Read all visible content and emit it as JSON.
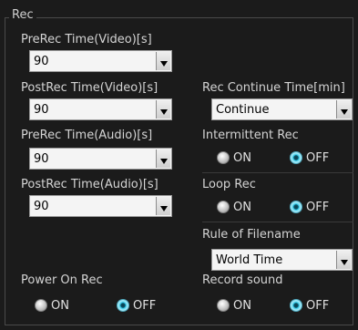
{
  "section_title": "Rec",
  "prerec_video": {
    "label": "PreRec Time(Video)[s]",
    "value": "90"
  },
  "postrec_video": {
    "label": "PostRec Time(Video)[s]",
    "value": "90"
  },
  "prerec_audio": {
    "label": "PreRec Time(Audio)[s]",
    "value": "90"
  },
  "postrec_audio": {
    "label": "PostRec Time(Audio)[s]",
    "value": "90"
  },
  "rec_continue": {
    "label": "Rec Continue Time[min]",
    "value": "Continue"
  },
  "intermittent": {
    "label": "Intermittent Rec",
    "on": "ON",
    "off": "OFF",
    "selected": "OFF"
  },
  "loop": {
    "label": "Loop Rec",
    "on": "ON",
    "off": "OFF",
    "selected": "OFF"
  },
  "filename_rule": {
    "label": "Rule of Filename",
    "value": "World Time"
  },
  "power_on": {
    "label": "Power On Rec",
    "on": "ON",
    "off": "OFF",
    "selected": "OFF"
  },
  "record_sound": {
    "label": "Record sound",
    "on": "ON",
    "off": "OFF",
    "selected": "OFF"
  }
}
